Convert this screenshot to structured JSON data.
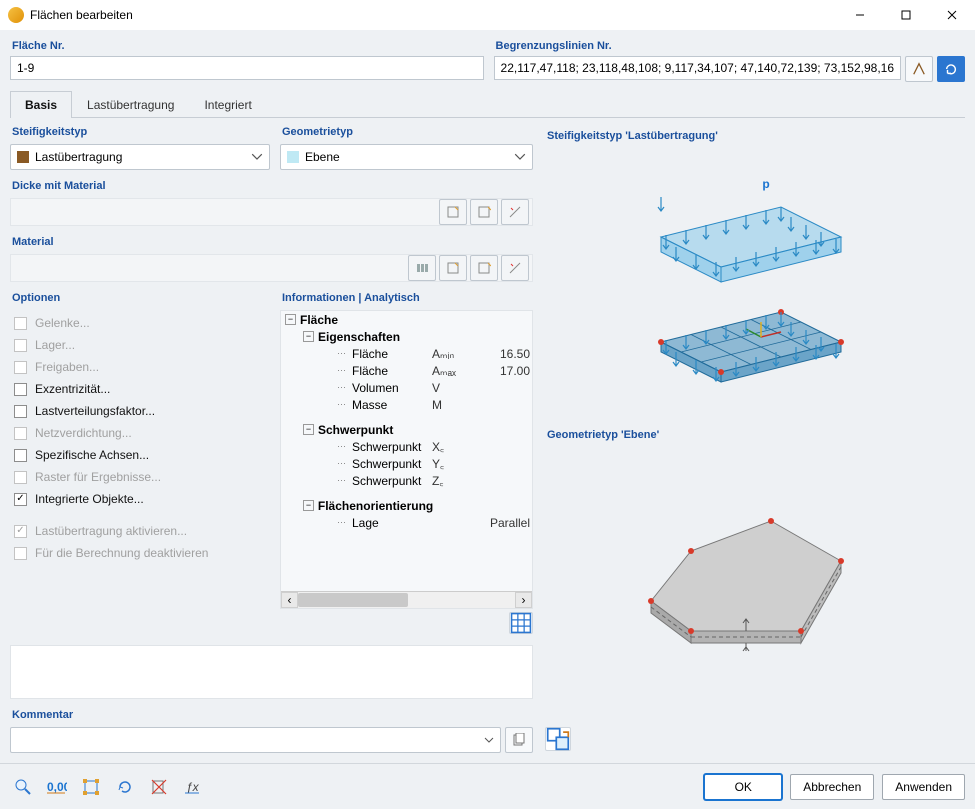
{
  "window": {
    "title": "Flächen bearbeiten"
  },
  "header": {
    "surface_no_label": "Fläche Nr.",
    "surface_no_value": "1-9",
    "boundary_label": "Begrenzungslinien Nr.",
    "boundary_value": "22,117,47,118; 23,118,48,108; 9,117,34,107; 47,140,72,139; 73,152,98,16"
  },
  "tabs": {
    "basis": "Basis",
    "last": "Lastübertragung",
    "integriert": "Integriert"
  },
  "stiffness": {
    "label": "Steifigkeitstyp",
    "value": "Lastübertragung",
    "swatch": "#8a5a24"
  },
  "geometry": {
    "label": "Geometrietyp",
    "value": "Ebene",
    "swatch": "#bfe9f4"
  },
  "thickness_label": "Dicke mit Material",
  "material_label": "Material",
  "options": {
    "label": "Optionen",
    "items": [
      {
        "text": "Gelenke...",
        "disabled": true,
        "checked": false
      },
      {
        "text": "Lager...",
        "disabled": true,
        "checked": false
      },
      {
        "text": "Freigaben...",
        "disabled": true,
        "checked": false
      },
      {
        "text": "Exzentrizität...",
        "disabled": false,
        "checked": false
      },
      {
        "text": "Lastverteilungsfaktor...",
        "disabled": false,
        "checked": false
      },
      {
        "text": "Netzverdichtung...",
        "disabled": true,
        "checked": false
      },
      {
        "text": "Spezifische Achsen...",
        "disabled": false,
        "checked": false
      },
      {
        "text": "Raster für Ergebnisse...",
        "disabled": true,
        "checked": false
      },
      {
        "text": "Integrierte Objekte...",
        "disabled": false,
        "checked": true
      },
      {
        "text": "",
        "disabled": true,
        "checked": false,
        "spacer": true
      },
      {
        "text": "Lastübertragung aktivieren...",
        "disabled": true,
        "checked": true
      },
      {
        "text": "Für die Berechnung deaktivieren",
        "disabled": true,
        "checked": false
      }
    ]
  },
  "info": {
    "header": "Informationen | Analytisch",
    "rows": [
      {
        "level": 0,
        "exp": "-",
        "a": "Fläche"
      },
      {
        "level": 1,
        "exp": "-",
        "a": "Eigenschaften"
      },
      {
        "level": 2,
        "a": "Fläche",
        "b": "Aₘᵢₙ",
        "c": "16.50"
      },
      {
        "level": 2,
        "a": "Fläche",
        "b": "Aₘₐₓ",
        "c": "17.00"
      },
      {
        "level": 2,
        "a": "Volumen",
        "b": "V"
      },
      {
        "level": 2,
        "a": "Masse",
        "b": "M"
      },
      {
        "level": 1,
        "spacer": true
      },
      {
        "level": 1,
        "exp": "-",
        "a": "Schwerpunkt"
      },
      {
        "level": 2,
        "a": "Schwerpunkt",
        "b": "X꜀"
      },
      {
        "level": 2,
        "a": "Schwerpunkt",
        "b": "Y꜀"
      },
      {
        "level": 2,
        "a": "Schwerpunkt",
        "b": "Z꜀"
      },
      {
        "level": 1,
        "spacer": true
      },
      {
        "level": 1,
        "exp": "-",
        "a": "Flächenorientierung"
      },
      {
        "level": 2,
        "a": "Lage",
        "b": "",
        "c": "Parallel"
      }
    ]
  },
  "comment_label": "Kommentar",
  "right": {
    "stiff_head": "Steifigkeitstyp 'Lastübertragung'",
    "geom_head": "Geometrietyp 'Ebene'",
    "p_label": "p"
  },
  "footer": {
    "ok": "OK",
    "cancel": "Abbrechen",
    "apply": "Anwenden"
  }
}
